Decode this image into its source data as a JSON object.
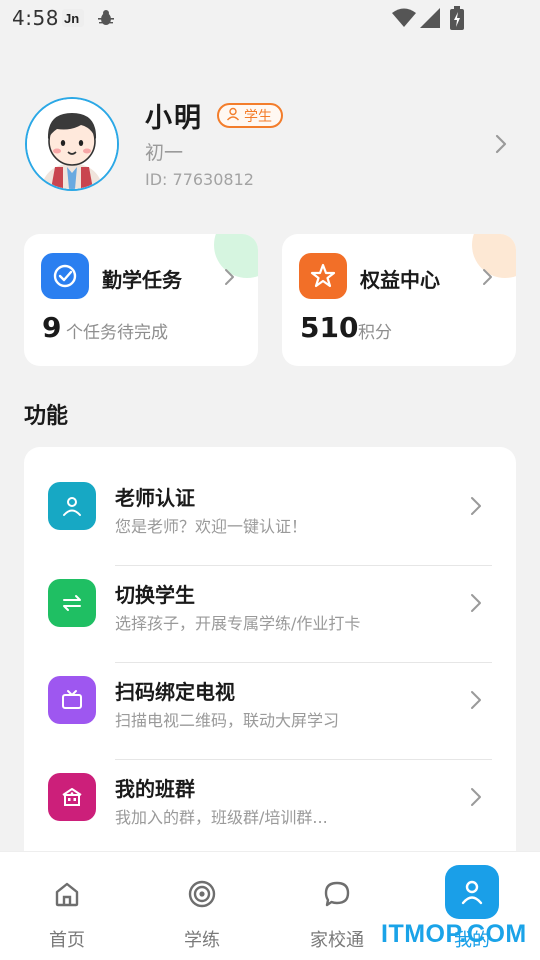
{
  "status_bar": {
    "time": "4:58"
  },
  "profile": {
    "name": "小明",
    "role_badge": "学生",
    "grade": "初一",
    "id_text": "ID: 77630812"
  },
  "quick_cards": [
    {
      "title": "勤学任务",
      "number": "9",
      "caption": "个任务待完成",
      "accent": "#2b7ff0",
      "deco": "#d6f5e0"
    },
    {
      "title": "权益中心",
      "number": "510",
      "caption": "积分",
      "accent": "#f26f28",
      "deco": "#fde8d4"
    }
  ],
  "section": {
    "title": "功能"
  },
  "functions": [
    {
      "title": "老师认证",
      "subtitle": "您是老师？欢迎一键认证！",
      "icon": "teacher-icon",
      "color": "#17a8c4"
    },
    {
      "title": "切换学生",
      "subtitle": "选择孩子，开展专属学练/作业打卡",
      "icon": "switch-icon",
      "color": "#1fbf63"
    },
    {
      "title": "扫码绑定电视",
      "subtitle": "扫描电视二维码，联动大屏学习",
      "icon": "tv-icon",
      "color": "#9e57f0"
    },
    {
      "title": "我的班群",
      "subtitle": "我加入的群，班级群/培训群...",
      "icon": "class-group-icon",
      "color": "#cc1f7a"
    }
  ],
  "bottom_nav": [
    {
      "label": "首页",
      "icon": "home-icon",
      "active": false
    },
    {
      "label": "学练",
      "icon": "target-icon",
      "active": false
    },
    {
      "label": "家校通",
      "icon": "chat-icon",
      "active": false
    },
    {
      "label": "我的",
      "icon": "profile-icon",
      "active": true
    }
  ],
  "watermark": "ITMOP.COM",
  "colors": {
    "accent": "#1a9fe8",
    "badge": "#f37d2b"
  }
}
